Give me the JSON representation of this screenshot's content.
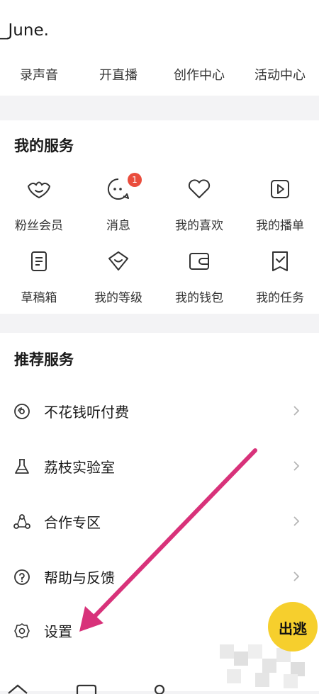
{
  "header": {
    "username": "_June."
  },
  "tools": [
    "录声音",
    "开直播",
    "创作中心",
    "活动中心"
  ],
  "services": {
    "title": "我的服务",
    "items": [
      {
        "label": "粉丝会员",
        "icon": "fan-member-icon"
      },
      {
        "label": "消息",
        "icon": "message-icon",
        "badge": "1"
      },
      {
        "label": "我的喜欢",
        "icon": "heart-icon"
      },
      {
        "label": "我的播单",
        "icon": "playlist-icon"
      },
      {
        "label": "草稿箱",
        "icon": "drafts-icon"
      },
      {
        "label": "我的等级",
        "icon": "level-icon"
      },
      {
        "label": "我的钱包",
        "icon": "wallet-icon"
      },
      {
        "label": "我的任务",
        "icon": "task-icon"
      }
    ]
  },
  "recommended": {
    "title": "推荐服务",
    "items": [
      {
        "label": "不花钱听付费",
        "icon": "disc-icon"
      },
      {
        "label": "荔枝实验室",
        "icon": "flask-icon"
      },
      {
        "label": "合作专区",
        "icon": "cooperation-icon"
      },
      {
        "label": "帮助与反馈",
        "icon": "help-icon"
      },
      {
        "label": "设置",
        "icon": "gear-icon"
      }
    ]
  },
  "sticker": {
    "text": "出逃"
  },
  "colors": {
    "annotation_arrow": "#d8327a",
    "badge": "#ea4d3d",
    "sticker": "#f6cf2d"
  }
}
